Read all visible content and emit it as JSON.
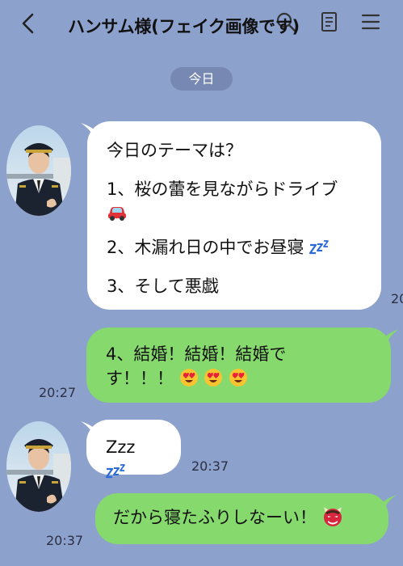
{
  "header": {
    "title": "ハンサム様(フェイク画像です)"
  },
  "date_divider": "今日",
  "messages": {
    "m1": {
      "line1": "今日のテーマは？",
      "line2": "1、桜の蕾を見ながらドライブ",
      "line3": "2、木漏れ日の中でお昼寝",
      "line4": "3、そして悪戯",
      "time": "20"
    },
    "m2": {
      "line1": "4、結婚！結婚！結婚で",
      "line2": "す！！！",
      "time": "20:27"
    },
    "m3": {
      "text": "Zzz",
      "time": "20:37"
    },
    "m4": {
      "text": "だから寝たふりしなーい！",
      "time": "20:37"
    }
  },
  "icons": {
    "back": "chevron-left-icon",
    "search": "search-icon",
    "note": "note-icon",
    "menu": "hamburger-menu-icon",
    "car": "red-car-emoji",
    "zzz": "zzz-sleep-emoji",
    "heart_eyes": "heart-eyes-emoji",
    "oni": "oni-mask-emoji"
  },
  "colors": {
    "background": "#8da1cd",
    "incoming_bubble": "#ffffff",
    "outgoing_bubble": "#86d96c",
    "date_pill": "#7788b3"
  }
}
